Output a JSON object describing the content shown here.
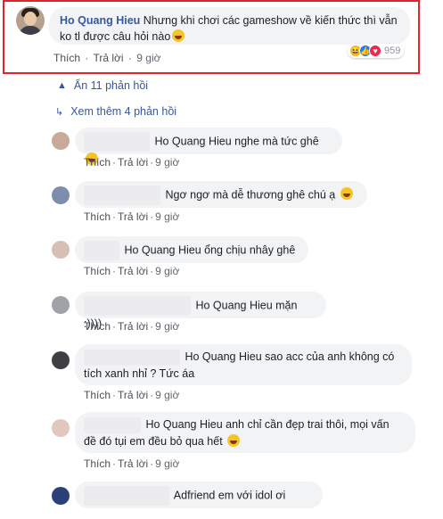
{
  "top_comment": {
    "author": "Ho Quang Hieu",
    "text_line1": "Nhưng khi chơi các gameshow về kiến thức thì vẫn",
    "text_line2": "ko tl được câu hỏi nào",
    "like_label": "Thích",
    "reply_label": "Trả lời",
    "time": "9 giờ",
    "reaction_count": "959",
    "reactions": [
      "haha",
      "like",
      "love"
    ]
  },
  "thread": {
    "hide_label": "Ẩn 11 phản hồi",
    "more_label": "Xem thêm 4 phản hồi"
  },
  "replies": [
    {
      "text": "Ho Quang Hieu nghe mà tức ghê",
      "emoji": "grin",
      "like_label": "Thích",
      "reply_label": "Trả lời",
      "time": "9 giờ"
    },
    {
      "text": "Ngơ ngơ mà dễ thương ghê chú ạ",
      "emoji": "rofl",
      "like_label": "Thích",
      "reply_label": "Trả lời",
      "time": "9 giờ"
    },
    {
      "text": "Ho Quang Hieu ổng chịu nhây ghê",
      "like_label": "Thích",
      "reply_label": "Trả lời",
      "time": "9 giờ"
    },
    {
      "text": "Ho Quang Hieu mặn :))))",
      "like_label": "Thích",
      "reply_label": "Trả lời",
      "time": "9 giờ"
    },
    {
      "text_line1": "Ho Quang Hieu sao acc của anh không có",
      "text_line2": "tích xanh nhỉ ? Tức áa",
      "like_label": "Thích",
      "reply_label": "Trả lời",
      "time": "9 giờ"
    },
    {
      "text_line1": "Ho Quang Hieu anh chỉ cần đẹp trai thôi, mọi vấn",
      "text_line2": "đề đó tụi em đều bỏ qua hết",
      "emoji": "pleading",
      "like_label": "Thích",
      "reply_label": "Trả lời",
      "time": "9 giờ"
    },
    {
      "text": "Adfriend em với idol ơi"
    }
  ],
  "colors": {
    "highlight_border": "#e0262b",
    "link": "#385898",
    "bubble": "#f2f3f5"
  }
}
